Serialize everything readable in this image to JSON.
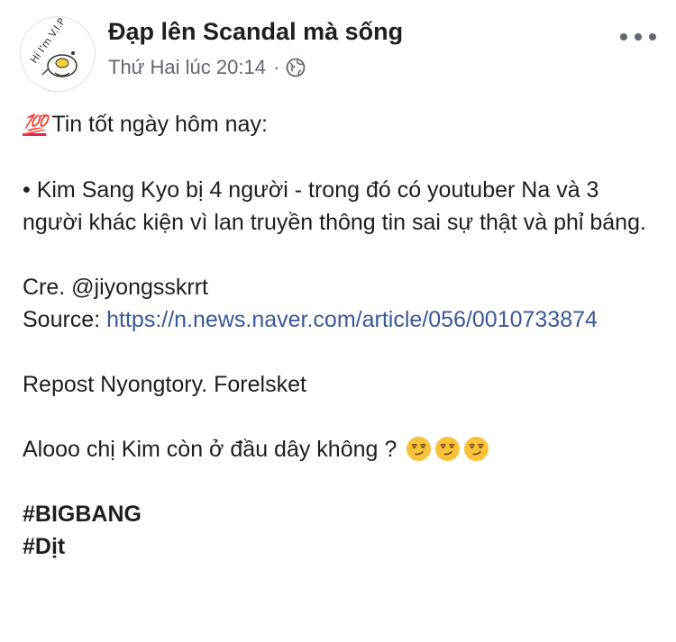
{
  "post": {
    "page_name": "Đạp lên Scandal mà sống",
    "timestamp": "Thứ Hai lúc 20:14",
    "separator": "·",
    "privacy_icon": "globe-icon",
    "more_icon": "more-dots-icon",
    "avatar_text": "Hi I'm V.I.P",
    "body": {
      "headline_emoji": "💯",
      "headline_emoji_icon": "hundred-points-icon",
      "headline": "Tin tốt ngày hôm nay:",
      "bullet": "• Kim Sang Kyo bị 4 người - trong đó có youtuber Na và 3 người khác kiện vì lan truyền thông tin sai sự thật và phỉ báng.",
      "credit": "Cre. @jiyongsskrrt",
      "source_label": "Source:",
      "source_url": "https://n.news.naver.com/article/056/0010733874",
      "repost": "Repost Nyongtory. Forelsket",
      "question": "Alooo chị Kim còn ở đầu dây không ?",
      "question_emoji_icon": "smirking-face-icon",
      "hashtags": [
        "#BIGBANG",
        "#Dịt"
      ]
    }
  },
  "colors": {
    "text": "#1c1e21",
    "meta": "#606770",
    "link": "#385898",
    "background": "#ffffff"
  }
}
